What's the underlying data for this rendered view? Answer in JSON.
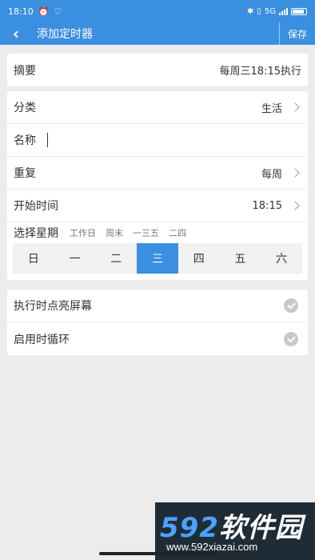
{
  "status_bar": {
    "time": "18:10",
    "network": "5G"
  },
  "app_bar": {
    "title": "添加定时器",
    "save_label": "保存"
  },
  "summary": {
    "label": "摘要",
    "value": "每周三18:15执行"
  },
  "category": {
    "label": "分类",
    "value": "生活"
  },
  "name": {
    "label": "名称",
    "value": ""
  },
  "repeat": {
    "label": "重复",
    "value": "每周"
  },
  "start_time": {
    "label": "开始时间",
    "value": "18:15"
  },
  "weekday": {
    "label": "选择星期",
    "quick_options": [
      "工作日",
      "周末",
      "一三五",
      "二四"
    ],
    "days": [
      "日",
      "一",
      "二",
      "三",
      "四",
      "五",
      "六"
    ],
    "selected": "三"
  },
  "toggles": [
    {
      "label": "执行时点亮屏幕",
      "checked": true
    },
    {
      "label": "启用时循环",
      "checked": true
    }
  ],
  "watermark": {
    "logo_num": "592",
    "logo_text": "软件园",
    "url": "www.592xiazai.com"
  }
}
